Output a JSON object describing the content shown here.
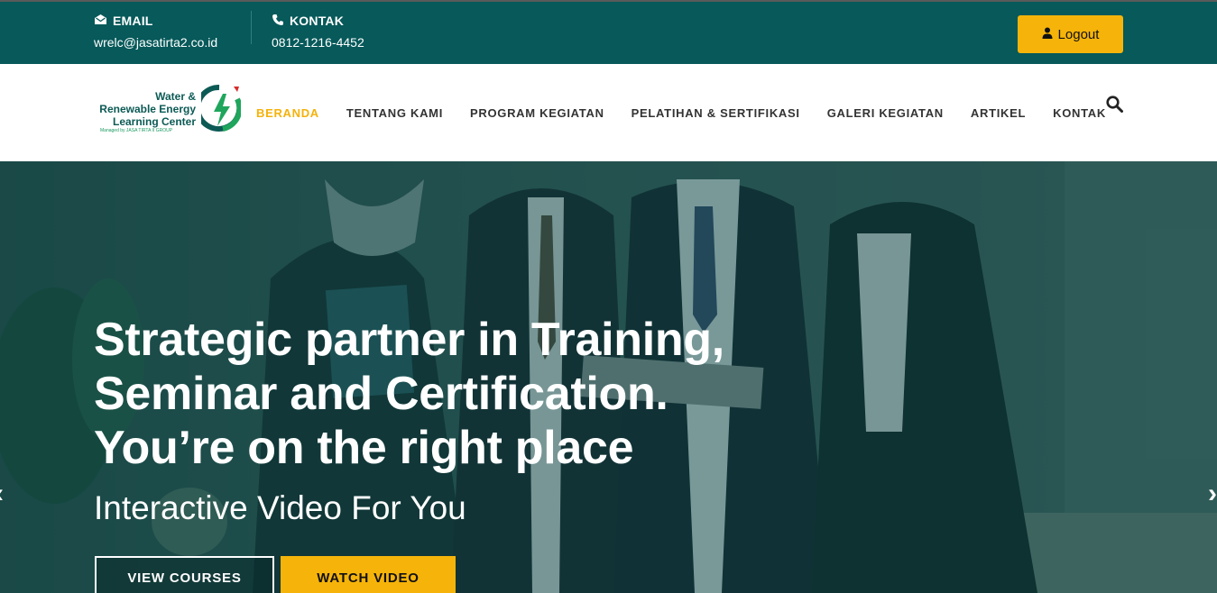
{
  "topbar": {
    "email_label": "EMAIL",
    "email_value": "wrelc@jasatirta2.co.id",
    "contact_label": "KONTAK",
    "contact_value": "0812-1216-4452",
    "logout_label": "Logout"
  },
  "logo": {
    "line1": "Water &",
    "line2": "Renewable Energy",
    "line3": "Learning Center",
    "sub": "Managed by JASA TIRTA II GROUP"
  },
  "nav": {
    "items": [
      {
        "label": "BERANDA"
      },
      {
        "label": "TENTANG KAMI"
      },
      {
        "label": "PROGRAM KEGIATAN"
      },
      {
        "label": "PELATIHAN & SERTIFIKASI"
      },
      {
        "label": "GALERI KEGIATAN"
      },
      {
        "label": "ARTIKEL"
      },
      {
        "label": "KONTAK"
      }
    ],
    "search_icon": "search-icon"
  },
  "hero": {
    "title_lines": [
      "Strategic partner in Training,",
      "Seminar and Certification.",
      "You’re on the right place"
    ],
    "subtitle": "Interactive Video For You",
    "btn_courses": "VIEW COURSES",
    "btn_video": "WATCH VIDEO",
    "prev_arrow": "‹",
    "next_arrow": "›"
  },
  "colors": {
    "topbar_bg": "#07595a",
    "accent": "#f6b40a",
    "nav_active": "#f4b20c"
  }
}
